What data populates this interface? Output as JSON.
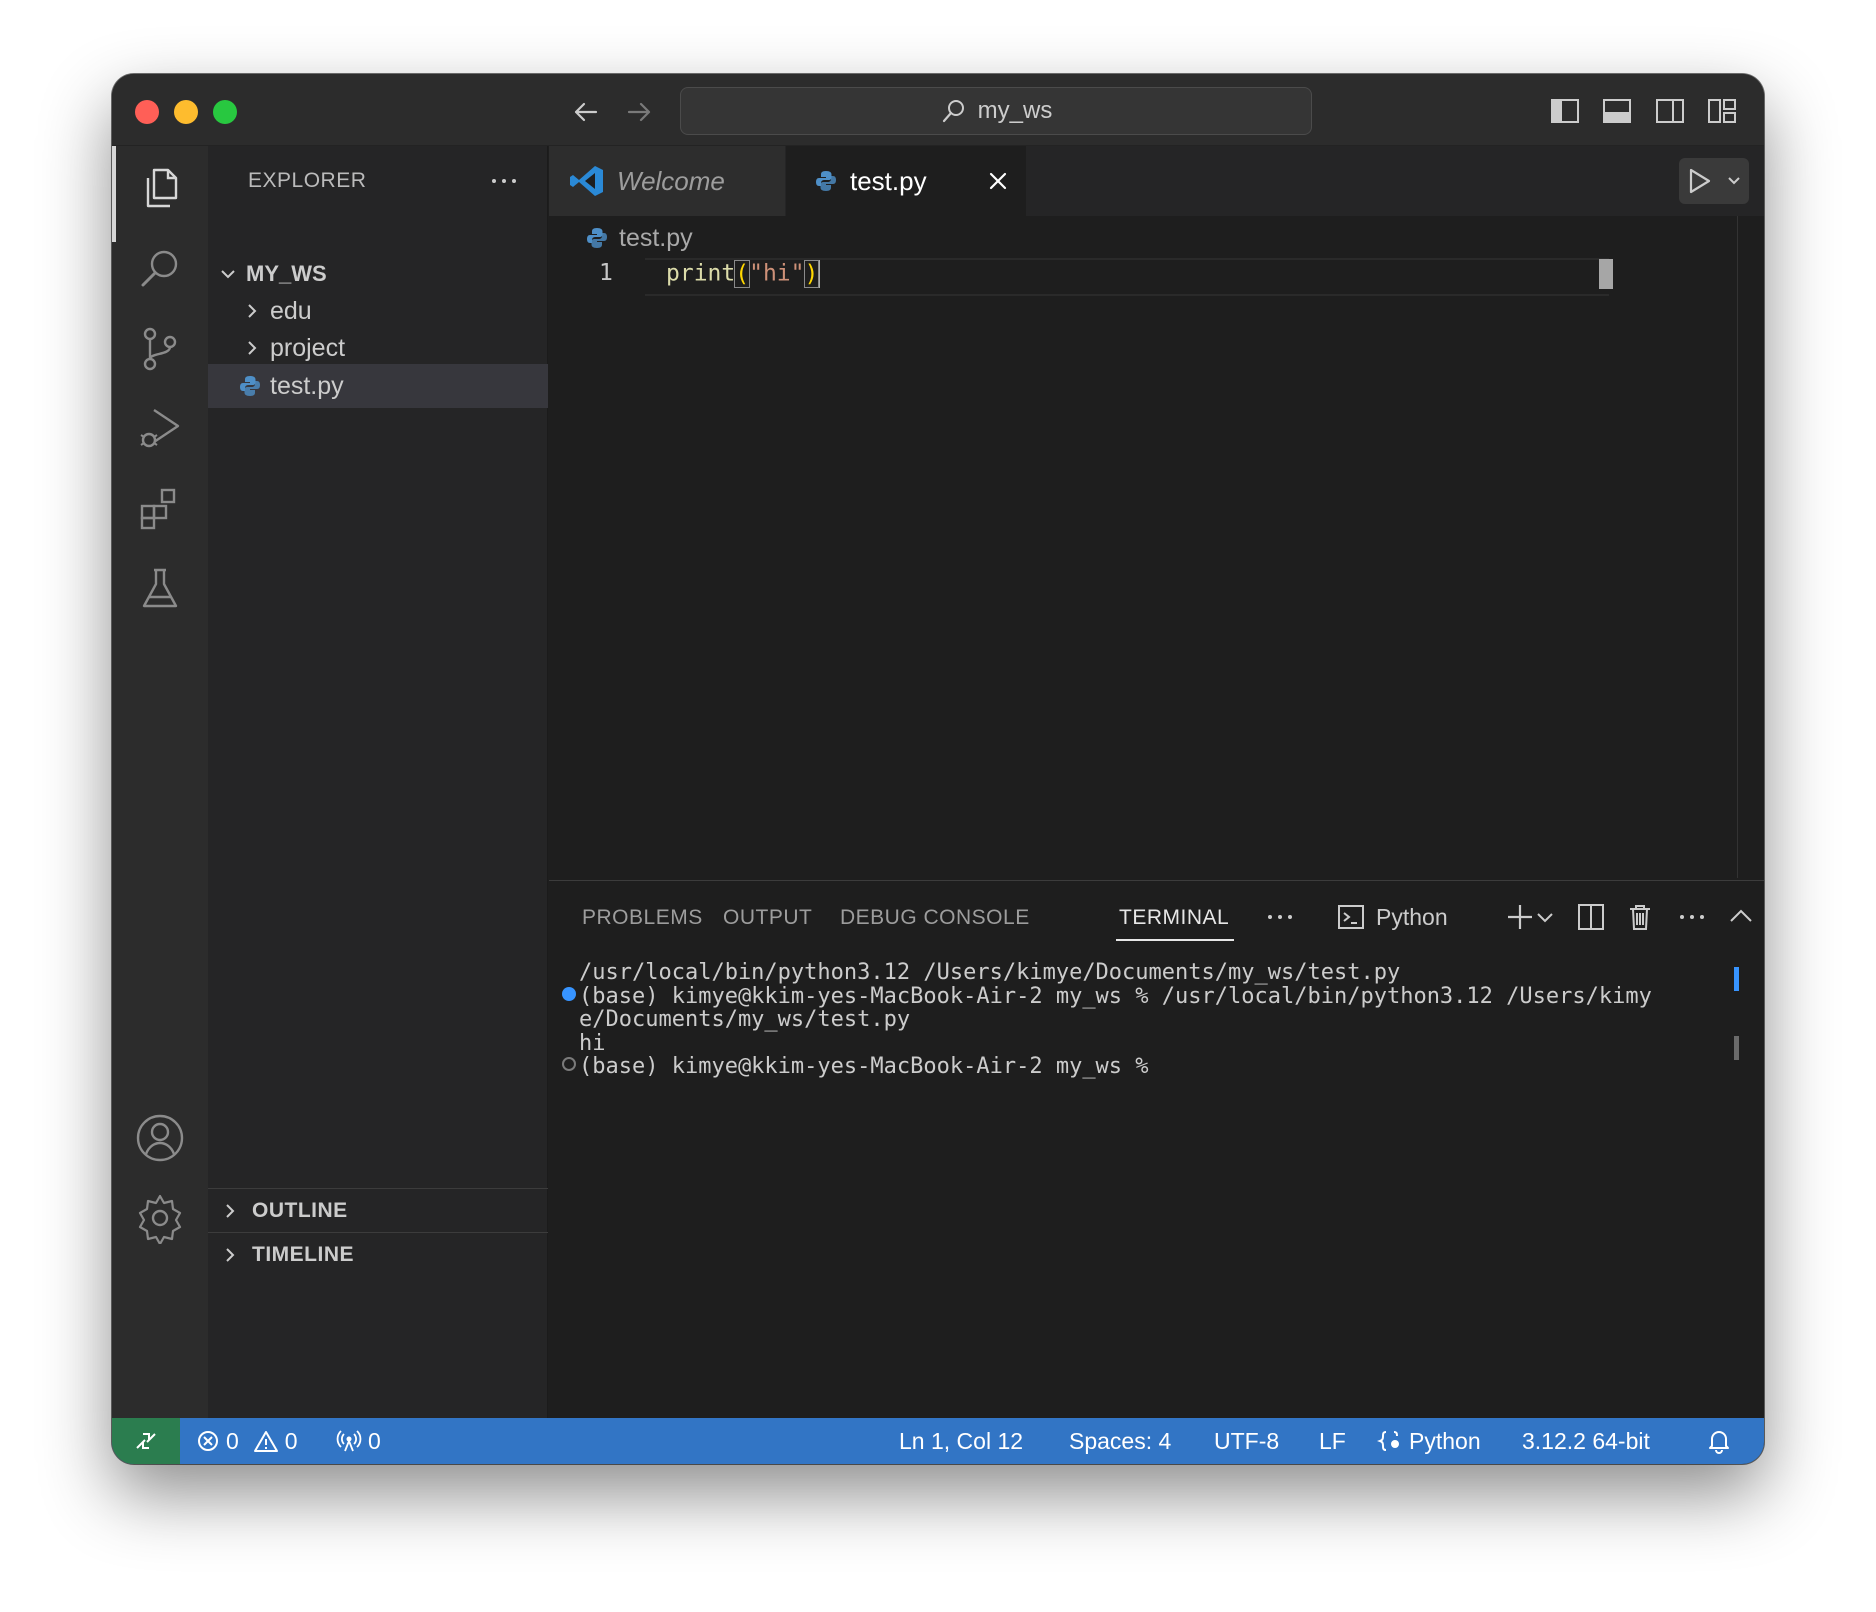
{
  "window": {
    "command_center": "my_ws",
    "colors": {
      "editor_bg": "#1e1e1e",
      "sidebar_bg": "#252526",
      "status_bar": "#3275c5",
      "remote_indicator": "#2b7d4f",
      "accent": "#3794ff"
    }
  },
  "sidebar": {
    "title": "EXPLORER",
    "root": "MY_WS",
    "items": [
      {
        "label": "edu",
        "kind": "folder"
      },
      {
        "label": "project",
        "kind": "folder"
      },
      {
        "label": "test.py",
        "kind": "python-file",
        "selected": true
      }
    ],
    "sections": [
      {
        "label": "OUTLINE"
      },
      {
        "label": "TIMELINE"
      }
    ]
  },
  "tabs": [
    {
      "label": "Welcome",
      "icon": "vscode-icon",
      "active": false
    },
    {
      "label": "test.py",
      "icon": "python-icon",
      "active": true
    }
  ],
  "editor": {
    "breadcrumb": "test.py",
    "lines": [
      {
        "number": "1",
        "tokens": {
          "fn": "print",
          "open": "(",
          "str": "\"hi\"",
          "close": ")"
        }
      }
    ]
  },
  "panel": {
    "tabs": [
      {
        "label": "PROBLEMS"
      },
      {
        "label": "OUTPUT"
      },
      {
        "label": "DEBUG CONSOLE"
      },
      {
        "label": "TERMINAL",
        "active": true
      }
    ],
    "terminal_profile": "Python",
    "terminal_lines": [
      "/usr/local/bin/python3.12 /Users/kimye/Documents/my_ws/test.py",
      "(base) kimye@kkim-yes-MacBook-Air-2 my_ws % /usr/local/bin/python3.12 /Users/kimy",
      "e/Documents/my_ws/test.py",
      "hi",
      "(base) kimye@kkim-yes-MacBook-Air-2 my_ws % "
    ]
  },
  "statusbar": {
    "errors": "0",
    "warnings": "0",
    "ports": "0",
    "position": "Ln 1, Col 12",
    "spaces": "Spaces: 4",
    "encoding": "UTF-8",
    "eol": "LF",
    "language": "Python",
    "interpreter": "3.12.2 64-bit"
  }
}
